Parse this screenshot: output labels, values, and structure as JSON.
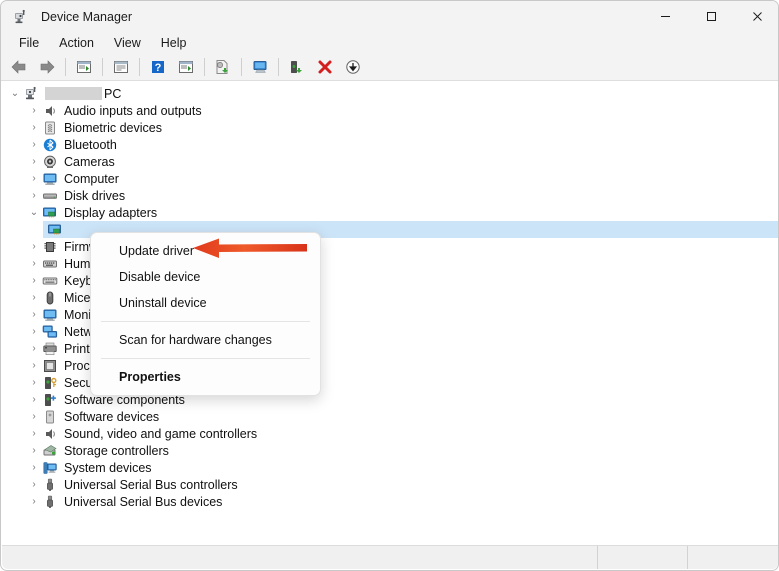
{
  "window": {
    "title": "Device Manager",
    "icon": "device-manager-icon",
    "controls": {
      "minimize": "─",
      "maximize": "□",
      "close": "✕"
    }
  },
  "menubar": {
    "items": [
      {
        "label": "File"
      },
      {
        "label": "Action"
      },
      {
        "label": "View"
      },
      {
        "label": "Help"
      }
    ]
  },
  "toolbar": {
    "buttons": [
      {
        "name": "back-icon"
      },
      {
        "name": "forward-icon"
      },
      {
        "name": "show-hidden-devices-icon"
      },
      {
        "name": "properties-icon"
      },
      {
        "name": "help-icon"
      },
      {
        "name": "play-icon"
      },
      {
        "name": "update-driver-icon"
      },
      {
        "name": "scan-for-hardware-changes-icon"
      },
      {
        "name": "uninstall-device-icon"
      },
      {
        "name": "delete-icon"
      },
      {
        "name": "download-icon"
      }
    ]
  },
  "tree": {
    "root": {
      "label": "PC",
      "redacted_prefix": true,
      "expanded": true,
      "icon": "computer-root-icon"
    },
    "items": [
      {
        "label": "Audio inputs and outputs",
        "icon": "speaker-icon",
        "expanded": false,
        "selected": false,
        "level": 1
      },
      {
        "label": "Biometric devices",
        "icon": "fingerprint-icon",
        "expanded": false,
        "selected": false,
        "level": 1
      },
      {
        "label": "Bluetooth",
        "icon": "bluetooth-icon",
        "expanded": false,
        "selected": false,
        "level": 1
      },
      {
        "label": "Cameras",
        "icon": "camera-icon",
        "expanded": false,
        "selected": false,
        "level": 1
      },
      {
        "label": "Computer",
        "icon": "monitor-icon",
        "expanded": false,
        "selected": false,
        "level": 1
      },
      {
        "label": "Disk drives",
        "icon": "disk-drive-icon",
        "expanded": false,
        "selected": false,
        "level": 1
      },
      {
        "label": "Display adapters",
        "icon": "display-adapter-icon",
        "expanded": true,
        "selected": false,
        "level": 1
      },
      {
        "label": "",
        "icon": "display-adapter-child-icon",
        "expanded": null,
        "selected": true,
        "level": 2
      },
      {
        "label": "Firmware",
        "icon": "firmware-icon",
        "expanded": false,
        "selected": false,
        "level": 1
      },
      {
        "label": "Human Interface Devices",
        "icon": "hid-icon",
        "expanded": false,
        "selected": false,
        "level": 1
      },
      {
        "label": "Keyboards",
        "icon": "keyboard-icon",
        "expanded": false,
        "selected": false,
        "level": 1
      },
      {
        "label": "Mice and other pointing devices",
        "icon": "mouse-icon",
        "expanded": false,
        "selected": false,
        "level": 1
      },
      {
        "label": "Monitors",
        "icon": "monitor-icon",
        "expanded": false,
        "selected": false,
        "level": 1
      },
      {
        "label": "Network adapters",
        "icon": "network-adapter-icon",
        "expanded": false,
        "selected": false,
        "level": 1
      },
      {
        "label": "Print queues",
        "icon": "printer-icon",
        "expanded": false,
        "selected": false,
        "level": 1
      },
      {
        "label": "Processors",
        "icon": "processor-icon",
        "expanded": false,
        "selected": false,
        "level": 1
      },
      {
        "label": "Security devices",
        "icon": "security-device-icon",
        "expanded": false,
        "selected": false,
        "level": 1
      },
      {
        "label": "Software components",
        "icon": "software-component-icon",
        "expanded": false,
        "selected": false,
        "level": 1
      },
      {
        "label": "Software devices",
        "icon": "software-device-icon",
        "expanded": false,
        "selected": false,
        "level": 1
      },
      {
        "label": "Sound, video and game controllers",
        "icon": "speaker-icon",
        "expanded": false,
        "selected": false,
        "level": 1
      },
      {
        "label": "Storage controllers",
        "icon": "storage-controller-icon",
        "expanded": false,
        "selected": false,
        "level": 1
      },
      {
        "label": "System devices",
        "icon": "system-device-icon",
        "expanded": false,
        "selected": false,
        "level": 1
      },
      {
        "label": "Universal Serial Bus controllers",
        "icon": "usb-icon",
        "expanded": false,
        "selected": false,
        "level": 1
      },
      {
        "label": "Universal Serial Bus devices",
        "icon": "usb-icon",
        "expanded": false,
        "selected": false,
        "level": 1
      }
    ],
    "chevron_collapsed": "›",
    "chevron_expanded": "⌄"
  },
  "context_menu": {
    "items": [
      {
        "label": "Update driver",
        "bold": false,
        "separator_after": false
      },
      {
        "label": "Disable device",
        "bold": false,
        "separator_after": false
      },
      {
        "label": "Uninstall device",
        "bold": false,
        "separator_after": true
      },
      {
        "label": "Scan for hardware changes",
        "bold": false,
        "separator_after": true
      },
      {
        "label": "Properties",
        "bold": true,
        "separator_after": false
      }
    ]
  },
  "annotation": {
    "type": "arrow",
    "direction": "left",
    "color": "#e8371c",
    "points_at": "Update driver"
  },
  "colors": {
    "titlebar_bg": "#f3f3f3",
    "content_bg": "#ffffff",
    "selection": "#cce4f7",
    "accent_red": "#e8371c",
    "text": "#101010"
  },
  "statusbar": {
    "panels": [
      "",
      "",
      ""
    ]
  }
}
